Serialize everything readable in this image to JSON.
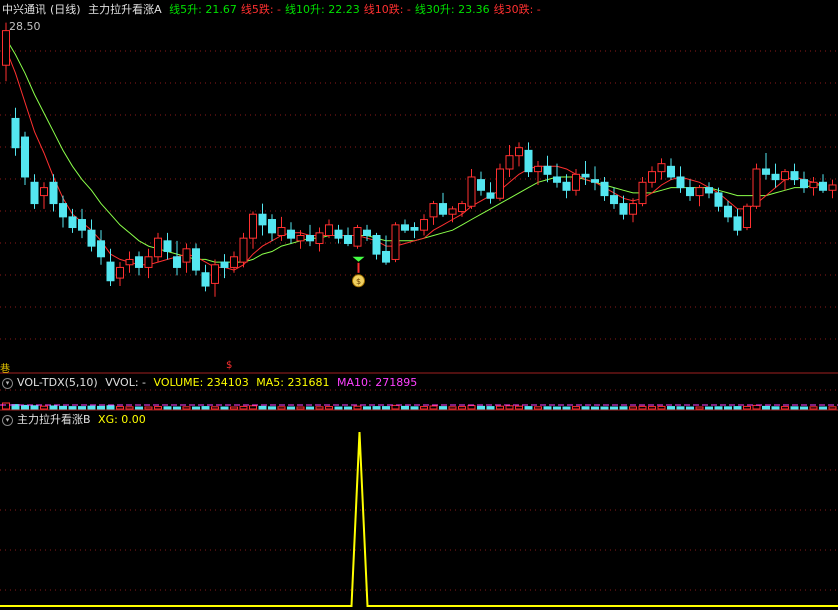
{
  "stock": {
    "name": "中兴通讯",
    "period": "(日线)"
  },
  "main_header": {
    "indicator": "主力拉升看涨A",
    "items": [
      {
        "label": "线5升",
        "value": "21.67",
        "color": "#00e000"
      },
      {
        "label": "线5跌",
        "value": "-",
        "color": "#ff3030"
      },
      {
        "label": "线10升",
        "value": "22.23",
        "color": "#00e000"
      },
      {
        "label": "线10跌",
        "value": "-",
        "color": "#ff3030"
      },
      {
        "label": "线30升",
        "value": "23.36",
        "color": "#00e000"
      },
      {
        "label": "线30跌",
        "value": "-",
        "color": "#ff3030"
      }
    ]
  },
  "price_label": "28.50",
  "vol_header": {
    "name": "VOL-TDX(5,10)",
    "vvol": "VVOL: -",
    "volume": "VOLUME: 234103",
    "ma5": "MA5: 231681",
    "ma10": "MA10: 271895"
  },
  "xg_header": {
    "name": "主力拉升看涨B",
    "xg": "XG: 0.00"
  },
  "markers": {
    "left": "巷",
    "dollar": "$"
  },
  "colors": {
    "up": "#ff3030",
    "down": "#54e6f0",
    "ma5": "#ff3030",
    "ma10": "#8aff4a",
    "yellow": "#ffff00",
    "grid": "#8b1a1a"
  },
  "chart_data": {
    "type": "candlestick",
    "candles": [
      [
        27.2,
        28.8,
        26.6,
        28.5
      ],
      [
        25.2,
        25.6,
        23.8,
        24.1
      ],
      [
        24.5,
        24.7,
        22.7,
        23.0
      ],
      [
        22.8,
        23.1,
        21.8,
        22.0
      ],
      [
        22.3,
        22.8,
        21.8,
        22.6
      ],
      [
        22.8,
        23.1,
        21.7,
        22.0
      ],
      [
        22.0,
        22.3,
        21.1,
        21.5
      ],
      [
        21.5,
        21.8,
        20.9,
        21.1
      ],
      [
        21.4,
        21.8,
        20.7,
        21.0
      ],
      [
        21.0,
        21.4,
        20.2,
        20.4
      ],
      [
        20.6,
        21.0,
        19.7,
        20.0
      ],
      [
        19.8,
        20.3,
        18.9,
        19.1
      ],
      [
        19.2,
        19.8,
        18.9,
        19.6
      ],
      [
        19.7,
        20.2,
        19.4,
        19.9
      ],
      [
        20.0,
        20.2,
        19.3,
        19.6
      ],
      [
        19.6,
        20.3,
        19.2,
        20.0
      ],
      [
        20.0,
        20.9,
        19.8,
        20.7
      ],
      [
        20.6,
        20.9,
        19.9,
        20.2
      ],
      [
        20.0,
        20.6,
        19.3,
        19.6
      ],
      [
        19.8,
        20.5,
        19.4,
        20.3
      ],
      [
        20.3,
        20.5,
        19.3,
        19.5
      ],
      [
        19.4,
        19.7,
        18.7,
        18.9
      ],
      [
        19.0,
        19.9,
        18.5,
        19.7
      ],
      [
        19.8,
        20.1,
        19.2,
        19.6
      ],
      [
        19.6,
        20.2,
        19.4,
        20.0
      ],
      [
        19.8,
        20.9,
        19.6,
        20.7
      ],
      [
        20.7,
        21.7,
        20.3,
        21.6
      ],
      [
        21.6,
        22.0,
        20.8,
        21.2
      ],
      [
        21.4,
        21.6,
        20.6,
        20.9
      ],
      [
        20.8,
        21.5,
        20.6,
        21.1
      ],
      [
        21.0,
        21.3,
        20.5,
        20.7
      ],
      [
        20.6,
        21.0,
        20.3,
        20.8
      ],
      [
        20.8,
        21.2,
        20.4,
        20.6
      ],
      [
        20.5,
        21.1,
        20.2,
        20.9
      ],
      [
        20.8,
        21.4,
        20.7,
        21.2
      ],
      [
        21.0,
        21.2,
        20.5,
        20.7
      ],
      [
        20.8,
        21.1,
        20.4,
        20.5
      ],
      [
        20.4,
        21.2,
        20.3,
        21.1
      ],
      [
        21.0,
        21.2,
        20.6,
        20.8
      ],
      [
        20.8,
        20.9,
        19.9,
        20.1
      ],
      [
        20.2,
        20.8,
        19.7,
        19.8
      ],
      [
        19.9,
        21.3,
        19.8,
        21.2
      ],
      [
        21.2,
        21.4,
        20.9,
        21.0
      ],
      [
        21.1,
        21.3,
        20.7,
        21.0
      ],
      [
        21.0,
        21.6,
        20.8,
        21.4
      ],
      [
        21.5,
        22.1,
        21.2,
        22.0
      ],
      [
        22.0,
        22.4,
        21.5,
        21.6
      ],
      [
        21.6,
        21.9,
        21.3,
        21.8
      ],
      [
        21.7,
        22.1,
        21.5,
        22.0
      ],
      [
        21.9,
        23.3,
        21.8,
        23.0
      ],
      [
        22.9,
        23.2,
        22.3,
        22.5
      ],
      [
        22.4,
        22.8,
        22.0,
        22.2
      ],
      [
        22.2,
        23.5,
        22.1,
        23.3
      ],
      [
        23.3,
        24.2,
        23.0,
        23.8
      ],
      [
        23.8,
        24.3,
        23.4,
        24.1
      ],
      [
        24.0,
        24.3,
        23.0,
        23.2
      ],
      [
        23.2,
        23.6,
        22.7,
        23.4
      ],
      [
        23.4,
        23.8,
        22.8,
        23.1
      ],
      [
        23.0,
        23.5,
        22.6,
        22.8
      ],
      [
        22.8,
        23.1,
        22.2,
        22.5
      ],
      [
        22.5,
        23.3,
        22.3,
        23.1
      ],
      [
        23.1,
        23.6,
        22.7,
        23.0
      ],
      [
        22.9,
        23.4,
        22.5,
        22.8
      ],
      [
        22.8,
        23.0,
        22.1,
        22.3
      ],
      [
        22.3,
        22.6,
        21.8,
        22.0
      ],
      [
        22.0,
        22.3,
        21.4,
        21.6
      ],
      [
        21.6,
        22.2,
        21.3,
        22.0
      ],
      [
        22.0,
        23.0,
        21.9,
        22.8
      ],
      [
        22.8,
        23.4,
        22.6,
        23.2
      ],
      [
        23.2,
        23.7,
        22.9,
        23.5
      ],
      [
        23.4,
        23.7,
        22.9,
        23.0
      ],
      [
        23.0,
        23.4,
        22.4,
        22.6
      ],
      [
        22.6,
        22.9,
        22.1,
        22.3
      ],
      [
        22.3,
        22.7,
        21.9,
        22.6
      ],
      [
        22.6,
        22.8,
        22.2,
        22.4
      ],
      [
        22.4,
        22.6,
        21.7,
        21.9
      ],
      [
        21.9,
        22.1,
        21.3,
        21.5
      ],
      [
        21.5,
        21.8,
        20.8,
        21.0
      ],
      [
        21.1,
        22.0,
        21.0,
        21.9
      ],
      [
        21.9,
        23.5,
        21.8,
        23.3
      ],
      [
        23.3,
        23.9,
        22.9,
        23.1
      ],
      [
        23.1,
        23.5,
        22.6,
        22.9
      ],
      [
        22.9,
        23.3,
        22.5,
        23.2
      ],
      [
        23.2,
        23.5,
        22.7,
        22.9
      ],
      [
        22.9,
        23.2,
        22.4,
        22.6
      ],
      [
        22.6,
        23.0,
        22.3,
        22.8
      ],
      [
        22.8,
        23.1,
        22.4,
        22.5
      ],
      [
        22.5,
        22.9,
        22.2,
        22.7
      ]
    ],
    "ma5": [
      27.8,
      26.9,
      25.8,
      24.7,
      23.9,
      23.0,
      22.2,
      21.6,
      21.3,
      21.0,
      20.6,
      20.1,
      19.9,
      19.8,
      19.7,
      19.7,
      19.8,
      19.9,
      20.0,
      20.1,
      20.0,
      19.8,
      19.6,
      19.6,
      19.5,
      19.7,
      20.1,
      20.4,
      20.6,
      20.8,
      20.9,
      20.9,
      20.8,
      20.8,
      20.8,
      20.8,
      20.8,
      20.8,
      20.7,
      20.6,
      20.4,
      20.4,
      20.5,
      20.6,
      20.7,
      21.0,
      21.2,
      21.4,
      21.6,
      21.9,
      22.1,
      22.3,
      22.5,
      22.8,
      23.1,
      23.3,
      23.4,
      23.4,
      23.4,
      23.3,
      23.1,
      22.9,
      22.8,
      22.6,
      22.4,
      22.2,
      22.1,
      22.2,
      22.4,
      22.7,
      22.9,
      23.0,
      22.9,
      22.8,
      22.6,
      22.4,
      22.1,
      21.8,
      21.8,
      22.0,
      22.3,
      22.6,
      22.9,
      23.0,
      22.9,
      22.8,
      22.7
    ],
    "ma10": [
      28.2,
      27.6,
      26.9,
      26.1,
      25.4,
      24.7,
      24.0,
      23.4,
      22.9,
      22.5,
      22.0,
      21.6,
      21.2,
      20.9,
      20.6,
      20.4,
      20.3,
      20.2,
      20.1,
      20.0,
      19.9,
      19.9,
      19.8,
      19.8,
      19.8,
      19.8,
      19.9,
      20.1,
      20.2,
      20.4,
      20.5,
      20.6,
      20.7,
      20.7,
      20.8,
      20.8,
      20.8,
      20.8,
      20.8,
      20.7,
      20.6,
      20.6,
      20.6,
      20.6,
      20.7,
      20.8,
      20.9,
      21.0,
      21.2,
      21.4,
      21.6,
      21.8,
      22.0,
      22.2,
      22.4,
      22.6,
      22.8,
      22.9,
      23.0,
      23.0,
      23.0,
      22.9,
      22.8,
      22.7,
      22.6,
      22.5,
      22.4,
      22.4,
      22.4,
      22.5,
      22.6,
      22.6,
      22.6,
      22.6,
      22.6,
      22.5,
      22.4,
      22.3,
      22.3,
      22.3,
      22.3,
      22.4,
      22.5,
      22.6,
      22.6,
      22.7,
      22.7
    ],
    "signal_index": 37,
    "volume": [
      30,
      22,
      18,
      16,
      14,
      15,
      13,
      12,
      12,
      14,
      13,
      16,
      12,
      11,
      10,
      10,
      12,
      11,
      10,
      11,
      10,
      12,
      11,
      10,
      10,
      13,
      16,
      13,
      11,
      11,
      10,
      10,
      10,
      11,
      12,
      10,
      10,
      14,
      11,
      12,
      12,
      18,
      13,
      11,
      12,
      15,
      12,
      11,
      12,
      17,
      13,
      12,
      14,
      16,
      14,
      12,
      11,
      11,
      10,
      10,
      12,
      11,
      10,
      10,
      10,
      11,
      11,
      13,
      12,
      13,
      12,
      11,
      10,
      10,
      10,
      11,
      11,
      12,
      13,
      18,
      13,
      11,
      12,
      11,
      10,
      11,
      10,
      11
    ],
    "xg": {
      "spike_index": 37,
      "value": 1
    }
  }
}
